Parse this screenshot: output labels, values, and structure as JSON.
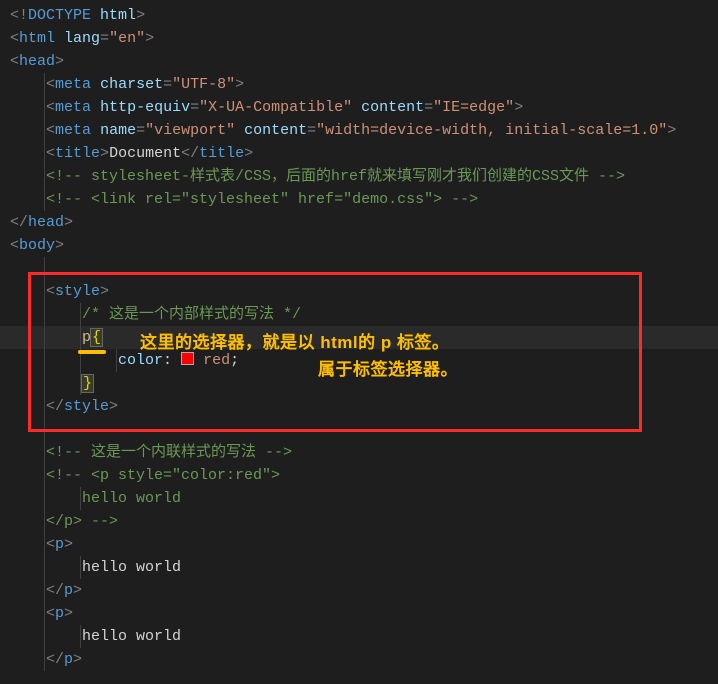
{
  "doc": {
    "doctype_kw": "DOCTYPE",
    "doctype_val": "html",
    "html_tag": "html",
    "lang_attr": "lang",
    "lang_val": "\"en\"",
    "head_tag": "head",
    "meta_tag": "meta",
    "charset_attr": "charset",
    "charset_val": "\"UTF-8\"",
    "httpequiv_attr": "http-equiv",
    "httpequiv_val": "\"X-UA-Compatible\"",
    "content_attr": "content",
    "content_ie": "\"IE=edge\"",
    "name_attr": "name",
    "viewport_val": "\"viewport\"",
    "content_vp": "\"width=device-width, initial-scale=1.0\"",
    "title_tag": "title",
    "title_text": "Document",
    "comment_css": "<!-- stylesheet-样式表/CSS，后面的href就来填写刚才我们创建的CSS文件 -->",
    "comment_link": "<!-- <link rel=\"stylesheet\" href=\"demo.css\"> -->",
    "body_tag": "body",
    "style_tag": "style",
    "css_comment": "/* 这是一个内部样式的写法 */",
    "selector_p": "p",
    "open_brace": "{",
    "close_brace": "}",
    "color_prop": "color",
    "color_val": "red",
    "colon": ":",
    "semicolon": ";",
    "comment_inline": "<!-- 这是一个内联样式的写法 -->",
    "comment_p_open": "<!-- <p style=\"color:red\">",
    "hello": "hello world",
    "p_close_cmt": "</p> -->",
    "p_tag": "p"
  },
  "annotation": {
    "line1": "这里的选择器，就是以 html的 p 标签。",
    "line2": "属于标签选择器。"
  },
  "colors": {
    "swatch": "#ff0000"
  }
}
